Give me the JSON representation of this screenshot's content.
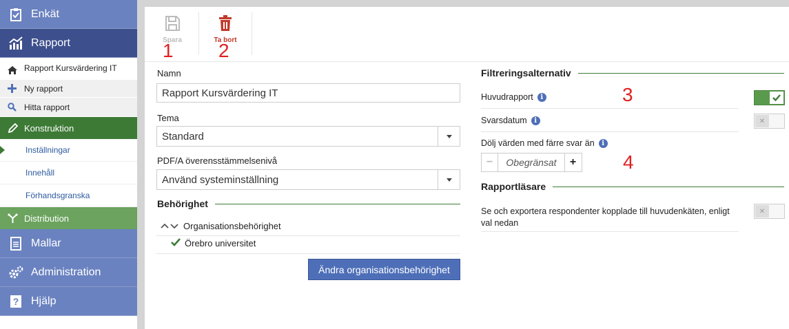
{
  "sidebar": {
    "enkat": "Enkät",
    "rapport": "Rapport",
    "current_report": "Rapport Kursvärdering IT",
    "ny_rapport": "Ny rapport",
    "hitta_rapport": "Hitta rapport",
    "konstruktion": "Konstruktion",
    "installningar": "Inställningar",
    "innehall": "Innehåll",
    "forhandsgranska": "Förhandsgranska",
    "distribution": "Distribution",
    "mallar": "Mallar",
    "administration": "Administration",
    "hjalp": "Hjälp"
  },
  "toolbar": {
    "save_label": "Spara",
    "delete_label": "Ta bort"
  },
  "annotations": [
    "1",
    "2",
    "3",
    "4"
  ],
  "form": {
    "name_label": "Namn",
    "name_value": "Rapport Kursvärdering IT",
    "theme_label": "Tema",
    "theme_value": "Standard",
    "pdfa_label": "PDF/A överensstämmelsenivå",
    "pdfa_value": "Använd systeminställning"
  },
  "permissions": {
    "heading": "Behörighet",
    "org_permission": "Organisationsbehörighet",
    "org_name": "Örebro universitet",
    "change_button": "Ändra organisationsbehörighet"
  },
  "filters": {
    "heading": "Filtreringsalternativ",
    "main_report": "Huvudrapport",
    "main_report_on": true,
    "response_date": "Svarsdatum",
    "response_date_on": false,
    "hide_values": "Dölj värden med färre svar än",
    "hide_values_value": "Obegränsat"
  },
  "readers": {
    "heading": "Rapportläsare",
    "export_text_line1": "Se och exportera respondenter kopplade till huvudenkäten, enligt",
    "export_text_line2": "val nedan",
    "export_on": false
  },
  "colors": {
    "nav_blue": "#6a82c0",
    "nav_blue_dark": "#3d4f8c",
    "nav_green": "#3d7a36",
    "accent_red": "#c0392b",
    "annotation_red": "#e02020"
  }
}
